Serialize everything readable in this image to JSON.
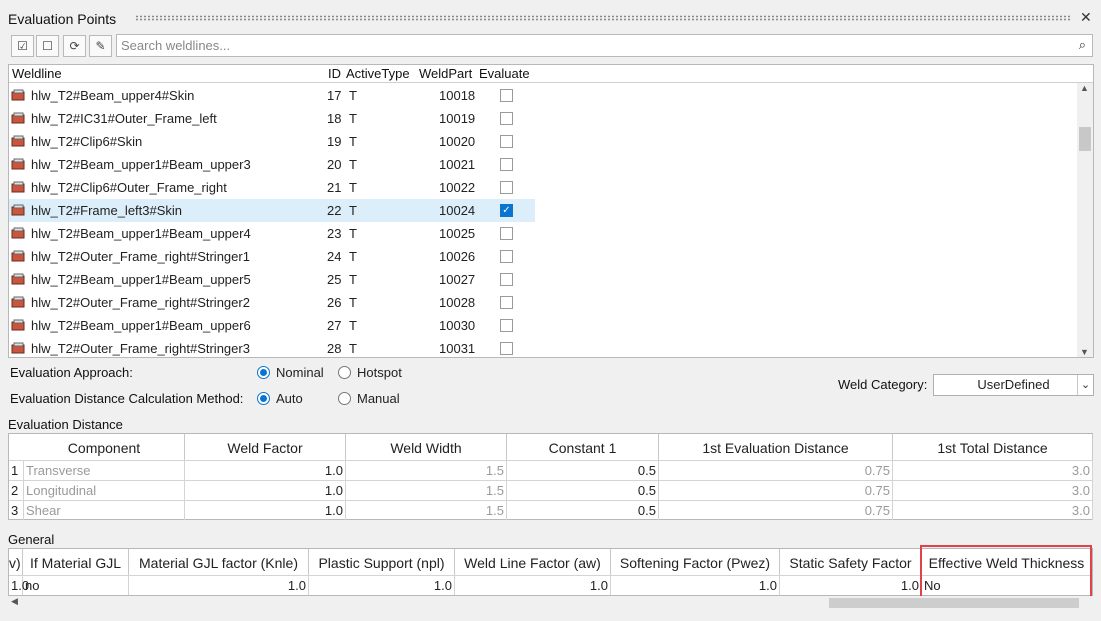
{
  "panel": {
    "title": "Evaluation Points",
    "close_glyph": "✕"
  },
  "toolbar": {
    "icons": [
      "check-all-icon",
      "uncheck-all-icon",
      "refresh-icon",
      "pick-icon"
    ],
    "search_placeholder": "Search weldlines..."
  },
  "weld_grid": {
    "columns": [
      "Weldline",
      "ID",
      "ActiveType",
      "WeldPart",
      "Evaluate"
    ],
    "rows": [
      {
        "weldline": "hlw_T2#Beam_upper4#Skin",
        "id": "17",
        "type": "T",
        "part": "10018",
        "evaluate": false,
        "selected": false
      },
      {
        "weldline": "hlw_T2#IC31#Outer_Frame_left",
        "id": "18",
        "type": "T",
        "part": "10019",
        "evaluate": false,
        "selected": false
      },
      {
        "weldline": "hlw_T2#Clip6#Skin",
        "id": "19",
        "type": "T",
        "part": "10020",
        "evaluate": false,
        "selected": false
      },
      {
        "weldline": "hlw_T2#Beam_upper1#Beam_upper3",
        "id": "20",
        "type": "T",
        "part": "10021",
        "evaluate": false,
        "selected": false
      },
      {
        "weldline": "hlw_T2#Clip6#Outer_Frame_right",
        "id": "21",
        "type": "T",
        "part": "10022",
        "evaluate": false,
        "selected": false
      },
      {
        "weldline": "hlw_T2#Frame_left3#Skin",
        "id": "22",
        "type": "T",
        "part": "10024",
        "evaluate": true,
        "selected": true
      },
      {
        "weldline": "hlw_T2#Beam_upper1#Beam_upper4",
        "id": "23",
        "type": "T",
        "part": "10025",
        "evaluate": false,
        "selected": false
      },
      {
        "weldline": "hlw_T2#Outer_Frame_right#Stringer1",
        "id": "24",
        "type": "T",
        "part": "10026",
        "evaluate": false,
        "selected": false
      },
      {
        "weldline": "hlw_T2#Beam_upper1#Beam_upper5",
        "id": "25",
        "type": "T",
        "part": "10027",
        "evaluate": false,
        "selected": false
      },
      {
        "weldline": "hlw_T2#Outer_Frame_right#Stringer2",
        "id": "26",
        "type": "T",
        "part": "10028",
        "evaluate": false,
        "selected": false
      },
      {
        "weldline": "hlw_T2#Beam_upper1#Beam_upper6",
        "id": "27",
        "type": "T",
        "part": "10030",
        "evaluate": false,
        "selected": false
      },
      {
        "weldline": "hlw_T2#Outer_Frame_right#Stringer3",
        "id": "28",
        "type": "T",
        "part": "10031",
        "evaluate": false,
        "selected": false
      }
    ]
  },
  "options": {
    "approach_label": "Evaluation Approach:",
    "approach_nominal": "Nominal",
    "approach_hotspot": "Hotspot",
    "approach_selected": "Nominal",
    "distance_method_label": "Evaluation Distance Calculation Method:",
    "method_auto": "Auto",
    "method_manual": "Manual",
    "method_selected": "Auto",
    "weld_category_label": "Weld Category:",
    "weld_category_value": "UserDefined"
  },
  "eval_distance": {
    "section": "Evaluation Distance",
    "columns": [
      "Component",
      "Weld Factor",
      "Weld Width",
      "Constant 1",
      "1st Evaluation Distance",
      "1st Total Distance"
    ],
    "rows": [
      {
        "n": "1",
        "component": "Transverse",
        "factor": "1.0",
        "width": "1.5",
        "constant": "0.5",
        "eval": "0.75",
        "total": "3.0"
      },
      {
        "n": "2",
        "component": "Longitudinal",
        "factor": "1.0",
        "width": "1.5",
        "constant": "0.5",
        "eval": "0.75",
        "total": "3.0"
      },
      {
        "n": "3",
        "component": "Shear",
        "factor": "1.0",
        "width": "1.5",
        "constant": "0.5",
        "eval": "0.75",
        "total": "3.0"
      }
    ]
  },
  "general": {
    "section": "General",
    "columns": [
      "v)",
      "If Material GJL",
      "Material GJL factor (Knle)",
      "Plastic Support (npl)",
      "Weld Line Factor (aw)",
      "Softening Factor (Pwez)",
      "Static Safety Factor",
      "Effective Weld Thickness"
    ],
    "row": [
      "1.0",
      "no",
      "1.0",
      "1.0",
      "1.0",
      "1.0",
      "1.0",
      "No"
    ]
  }
}
